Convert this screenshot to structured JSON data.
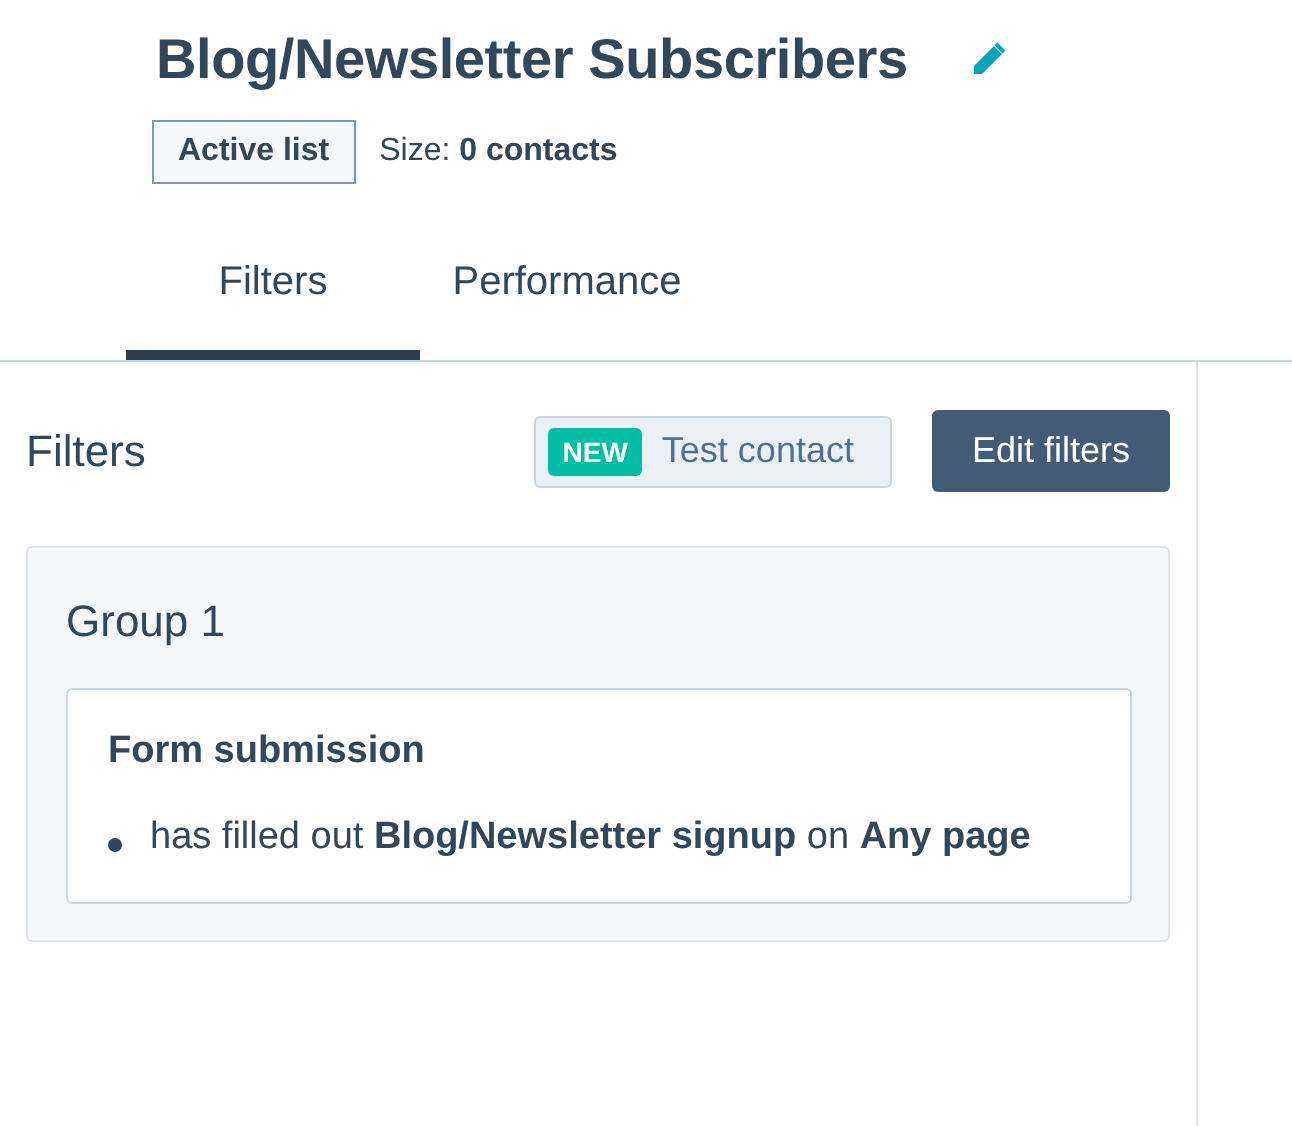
{
  "header": {
    "title": "Blog/Newsletter Subscribers",
    "list_type": "Active list",
    "size": "Size: **0 contacts**"
  },
  "tabs": [
    {
      "label": "Filters",
      "selected": true
    },
    {
      "label": "Performance",
      "selected": false
    }
  ],
  "filters": {
    "heading": "Filters",
    "test_contact": {
      "badge": "NEW",
      "label": "Test contact"
    },
    "edit_button": "Edit filters",
    "groups": [
      {
        "title": "Group 1",
        "criteria": [
          {
            "title": "Form submission",
            "conditions": [
              "has filled out **Blog/Newsletter signup** on **Any page**"
            ]
          }
        ]
      }
    ]
  }
}
